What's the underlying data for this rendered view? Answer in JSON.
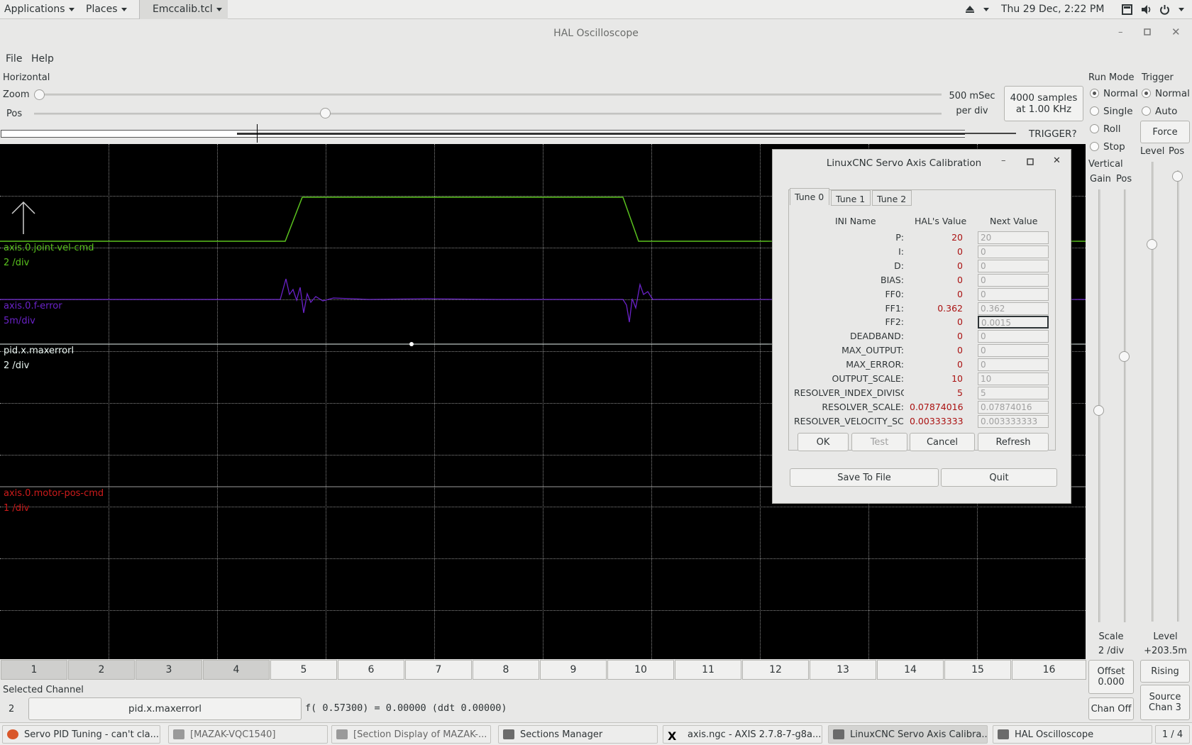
{
  "topbar": {
    "applications": "Applications",
    "places": "Places",
    "active_app": "Emccalib.tcl",
    "clock": "Thu 29 Dec,  2:22 PM"
  },
  "window": {
    "title": "HAL Oscilloscope"
  },
  "menu": {
    "file": "File",
    "help": "Help"
  },
  "horizontal": {
    "section": "Horizontal",
    "zoom_label": "Zoom",
    "pos_label": "Pos",
    "rate_line1": "500 mSec",
    "rate_line2": "per div",
    "samples_line1": "4000 samples",
    "samples_line2": "at 1.00 KHz",
    "trigger_status": "TRIGGER?",
    "zoom_value": 0.0,
    "pos_value": 0.32
  },
  "run_mode": {
    "title": "Run Mode",
    "options": [
      "Normal",
      "Single",
      "Roll",
      "Stop"
    ],
    "selected": "Normal"
  },
  "trigger": {
    "title": "Trigger",
    "options": [
      "Normal",
      "Auto"
    ],
    "selected": "Normal",
    "force": "Force",
    "level_label": "Level",
    "pos_label": "Pos",
    "level_value": "Level\n+203.5m",
    "level_title": "Level",
    "level_reading": "+203.5m",
    "rising": "Rising",
    "source_title": "Source",
    "source_value": "Chan  3"
  },
  "vertical": {
    "title": "Vertical",
    "gain_label": "Gain",
    "pos_label": "Pos",
    "scale_title": "Scale",
    "scale_value": "2 /div",
    "offset_title": "Offset",
    "offset_value": "0.000",
    "chan_off": "Chan Off"
  },
  "channels": [
    {
      "name": "axis.0.joint-vel-cmd",
      "scale": "2 /div",
      "color": "#5ac21e"
    },
    {
      "name": "axis.0.f-error",
      "scale": "5m/div",
      "color": "#6a22c8"
    },
    {
      "name": "pid.x.maxerrorl",
      "scale": "2 /div",
      "color": "#e8f4f0"
    },
    {
      "name": "axis.0.motor-pos-cmd",
      "scale": "1 /div",
      "color": "#cc1b1b"
    }
  ],
  "channel_buttons": [
    "1",
    "2",
    "3",
    "4",
    "5",
    "6",
    "7",
    "8",
    "9",
    "10",
    "11",
    "12",
    "13",
    "14",
    "15",
    "16"
  ],
  "selected_channel": {
    "title": "Selected Channel",
    "number": "2",
    "name": "pid.x.maxerrorl",
    "readout": "f( 0.57300) =  0.00000 (ddt  0.00000)"
  },
  "dialog": {
    "title": "LinuxCNC Servo Axis Calibration",
    "tabs": [
      "Tune 0",
      "Tune 1",
      "Tune 2"
    ],
    "col_ini": "INI Name",
    "col_hal": "HAL's Value",
    "col_next": "Next Value",
    "rows": [
      {
        "name": "P:",
        "hal": "20",
        "next": "20"
      },
      {
        "name": "I:",
        "hal": "0",
        "next": "0"
      },
      {
        "name": "D:",
        "hal": "0",
        "next": "0"
      },
      {
        "name": "BIAS:",
        "hal": "0",
        "next": "0"
      },
      {
        "name": "FF0:",
        "hal": "0",
        "next": "0"
      },
      {
        "name": "FF1:",
        "hal": "0.362",
        "next": "0.362"
      },
      {
        "name": "FF2:",
        "hal": "0",
        "next": "0.0015"
      },
      {
        "name": "DEADBAND:",
        "hal": "0",
        "next": "0"
      },
      {
        "name": "MAX_OUTPUT:",
        "hal": "0",
        "next": "0"
      },
      {
        "name": "MAX_ERROR:",
        "hal": "0",
        "next": "0"
      },
      {
        "name": "OUTPUT_SCALE:",
        "hal": "10",
        "next": "10"
      },
      {
        "name": "RESOLVER_INDEX_DIVISOR:",
        "hal": "5",
        "next": "5"
      },
      {
        "name": "RESOLVER_SCALE:",
        "hal": "0.07874016",
        "next": "0.07874016"
      },
      {
        "name": "RESOLVER_VELOCITY_SCALE:",
        "hal": "0.003333333",
        "next": "0.003333333"
      }
    ],
    "ok": "OK",
    "test": "Test",
    "cancel": "Cancel",
    "refresh": "Refresh",
    "save": "Save To File",
    "quit": "Quit"
  },
  "taskbar": {
    "items": [
      "Servo PID Tuning - can't cla...",
      "[MAZAK-VQC1540]",
      "[Section Display of MAZAK-...",
      "Sections Manager",
      "axis.ngc - AXIS 2.7.8-7-g8a...",
      "LinuxCNC Servo Axis Calibra...",
      "HAL Oscilloscope"
    ],
    "workspace": "1 / 4"
  }
}
